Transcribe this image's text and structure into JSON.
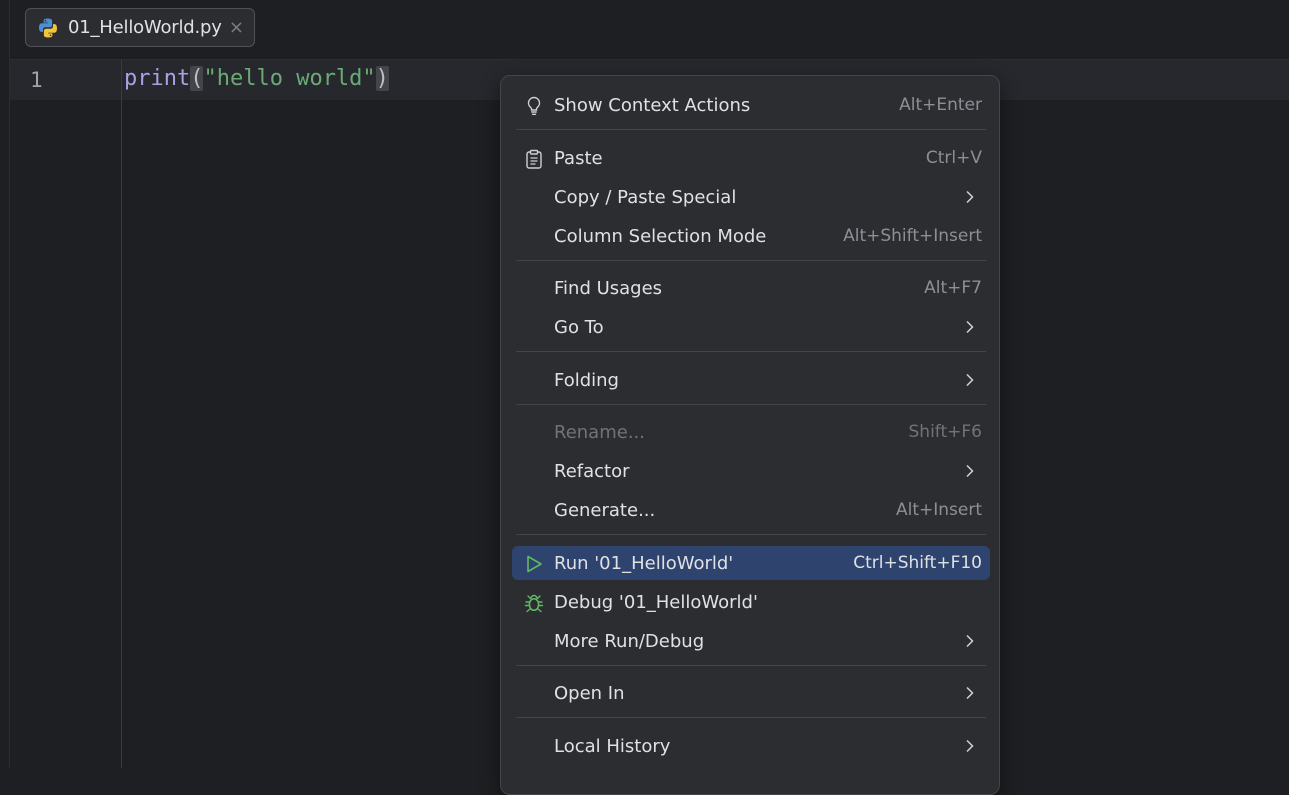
{
  "tab": {
    "label": "01_HelloWorld.py",
    "close": "×"
  },
  "editor": {
    "line_number": "1",
    "code": {
      "fn": "print",
      "open": "(",
      "str": "\"hello world\"",
      "close": ")"
    }
  },
  "menu": {
    "items": [
      {
        "label": "Show Context Actions",
        "shortcut": "Alt+Enter",
        "icon": "lightbulb-icon"
      },
      {
        "label": "Paste",
        "shortcut": "Ctrl+V",
        "icon": "clipboard-icon"
      },
      {
        "label": "Copy / Paste Special",
        "submenu": true
      },
      {
        "label": "Column Selection Mode",
        "shortcut": "Alt+Shift+Insert"
      },
      {
        "label": "Find Usages",
        "shortcut": "Alt+F7"
      },
      {
        "label": "Go To",
        "submenu": true
      },
      {
        "label": "Folding",
        "submenu": true
      },
      {
        "label": "Rename...",
        "shortcut": "Shift+F6",
        "disabled": true
      },
      {
        "label": "Refactor",
        "submenu": true
      },
      {
        "label": "Generate...",
        "shortcut": "Alt+Insert"
      },
      {
        "label": "Run '01_HelloWorld'",
        "shortcut": "Ctrl+Shift+F10",
        "icon": "run-icon",
        "selected": true
      },
      {
        "label": "Debug '01_HelloWorld'",
        "icon": "debug-bug-icon"
      },
      {
        "label": "More Run/Debug",
        "submenu": true
      },
      {
        "label": "Open In",
        "submenu": true
      },
      {
        "label": "Local History",
        "submenu": true
      }
    ]
  },
  "colors": {
    "accent_selected": "#2e436e",
    "run_green": "#5fb865",
    "string_green": "#6aab73",
    "function_purple": "#a9a1e4"
  }
}
